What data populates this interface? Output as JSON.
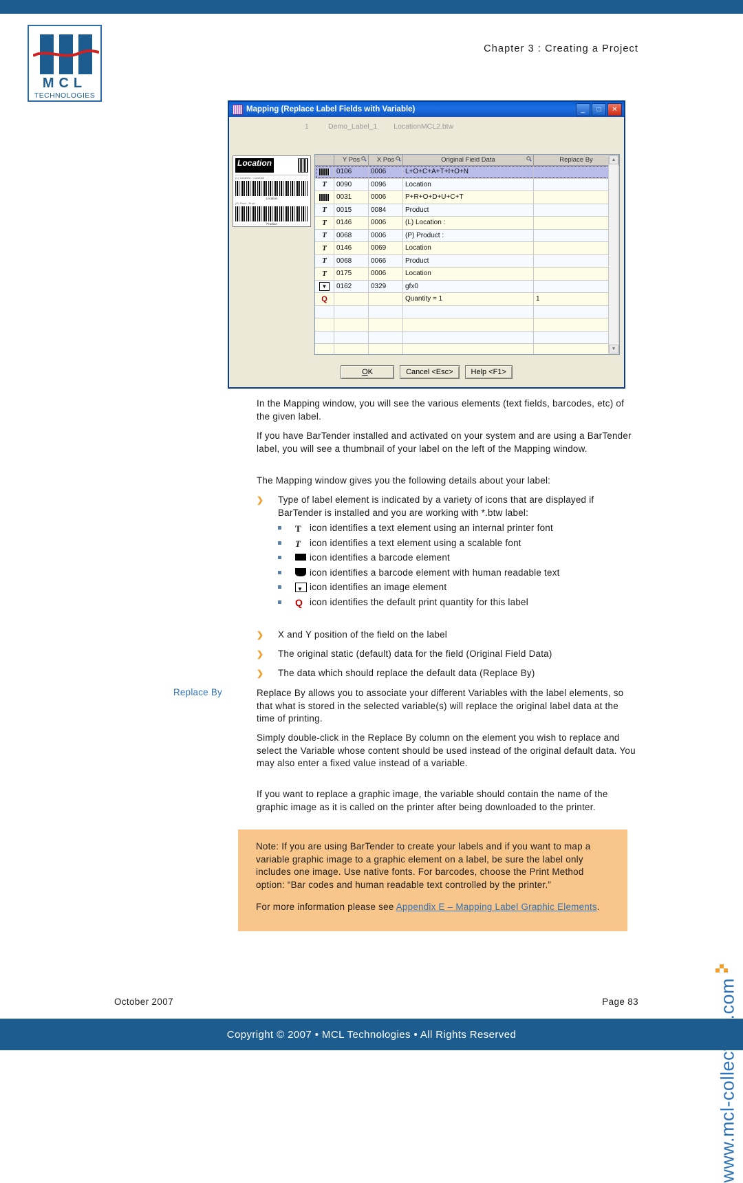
{
  "header": {
    "chapter": "Chapter 3 : Creating a Project",
    "logo_name": "MCL",
    "logo_sub": "TECHNOLOGIES"
  },
  "dialog": {
    "title": "Mapping (Replace Label Fields with Variable)",
    "minimize_label": "_",
    "maximize_label": "□",
    "close_label": "✕",
    "file_row": {
      "num": "1",
      "label": "Demo_Label_1",
      "file": "LocationMCL2.btw"
    },
    "preview": {
      "title": "Location",
      "caption_1": "(L) Location :   Location",
      "barcode_1_label": "Location",
      "caption_2": "(P) Prod..   Prod..",
      "barcode_2_label": "Product"
    },
    "columns": [
      "",
      "Y Pos",
      "X Pos",
      "Original Field Data",
      "Replace By"
    ],
    "rows": [
      {
        "icon": "barcode",
        "y": "0106",
        "x": "0006",
        "original": "L+O+C+A+T+I+O+N",
        "replace": "",
        "selected": true
      },
      {
        "icon": "text-scalable",
        "y": "0090",
        "x": "0096",
        "original": "Location",
        "replace": ""
      },
      {
        "icon": "barcode",
        "y": "0031",
        "x": "0006",
        "original": "P+R+O+D+U+C+T",
        "replace": ""
      },
      {
        "icon": "text-scalable",
        "y": "0015",
        "x": "0084",
        "original": "Product",
        "replace": ""
      },
      {
        "icon": "text-scalable",
        "y": "0146",
        "x": "0006",
        "original": "(L) Location :",
        "replace": ""
      },
      {
        "icon": "text-scalable",
        "y": "0068",
        "x": "0006",
        "original": "(P) Product :",
        "replace": ""
      },
      {
        "icon": "text-scalable",
        "y": "0146",
        "x": "0069",
        "original": "Location",
        "replace": ""
      },
      {
        "icon": "text-scalable",
        "y": "0068",
        "x": "0066",
        "original": "Product",
        "replace": ""
      },
      {
        "icon": "text-scalable",
        "y": "0175",
        "x": "0006",
        "original": "Location",
        "replace": ""
      },
      {
        "icon": "image",
        "y": "0162",
        "x": "0329",
        "original": "gfx0",
        "replace": ""
      },
      {
        "icon": "quantity",
        "y": "",
        "x": "",
        "original": "Quantity =  1",
        "replace": "1"
      },
      {
        "icon": "",
        "y": "",
        "x": "",
        "original": "",
        "replace": ""
      },
      {
        "icon": "",
        "y": "",
        "x": "",
        "original": "",
        "replace": ""
      },
      {
        "icon": "",
        "y": "",
        "x": "",
        "original": "",
        "replace": ""
      },
      {
        "icon": "",
        "y": "",
        "x": "",
        "original": "",
        "replace": ""
      },
      {
        "icon": "",
        "y": "",
        "x": "",
        "original": "",
        "replace": ""
      },
      {
        "icon": "",
        "y": "",
        "x": "",
        "original": "",
        "replace": ""
      }
    ],
    "buttons": {
      "ok": "OK",
      "cancel": "Cancel <Esc>",
      "help": "Help <F1>"
    }
  },
  "body": {
    "p1": "In the Mapping window, you will see the various elements (text fields, barcodes, etc) of the given label.",
    "p2": "If you have BarTender installed and activated on your system and are using a BarTender label, you will see a thumbnail of your label on the left of the Mapping window.",
    "p3": "The Mapping window gives you the following details about your label:",
    "b1": "Type of label element is indicated by a variety of icons that are displayed if BarTender is installed and you are working with *.btw label:",
    "sub1": "icon identifies a text element using an internal printer font",
    "sub2": "icon identifies a text element using a scalable font",
    "sub3": "icon identifies a barcode element",
    "sub4": "icon identifies a barcode element with human readable text",
    "sub5": "icon identifies an image element",
    "sub6": "icon identifies the default print quantity for this label",
    "b2": "X and Y position of the field on the label",
    "b3": "The original static (default) data for the field (Original Field Data)",
    "b4": "The data which should replace the default data (Replace By)",
    "margin_label": "Replace By",
    "p4": "Replace By allows you to associate your different Variables with the label elements, so that what is stored in the selected variable(s) will replace the original label data at the time of printing.",
    "p5": "Simply double-click in the Replace By column on the element you wish to replace and select the Variable whose content should be used instead of the original default data. You may also enter a fixed value instead of a variable.",
    "p6": "If you want to replace a graphic image, the variable should contain the name of the graphic image as it is called on the printer after being downloaded to the printer."
  },
  "note": {
    "text": "Note: If you are using BarTender to create your labels and if you want to map a variable graphic image to a graphic element on a label, be sure the label only includes one image. Use native fonts. For barcodes, choose the Print Method option: “Bar codes and human readable text controlled by the printer.”",
    "more_prefix": "For more information please see ",
    "link": "Appendix E – Mapping Label Graphic Elements",
    "more_suffix": "."
  },
  "watermark": {
    "text": "www.mcl-collection.com"
  },
  "footer": {
    "date": "October 2007",
    "page": "Page  83",
    "copyright": "Copyright © 2007 • MCL Technologies • All Rights Reserved"
  },
  "colors": {
    "brand_blue": "#1d5c8e",
    "accent_orange": "#f0a030",
    "note_bg": "#f8c58a",
    "link": "#2e72b8"
  }
}
